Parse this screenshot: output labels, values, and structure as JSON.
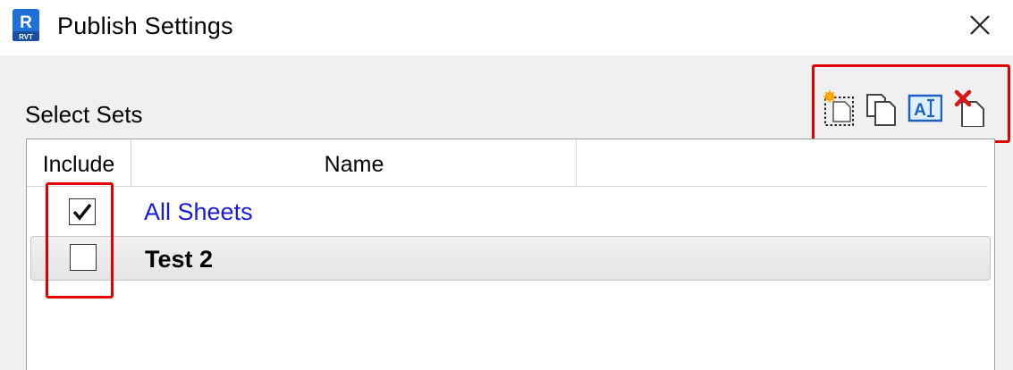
{
  "window": {
    "title": "Publish Settings",
    "app_icon_letter": "R",
    "app_icon_sub": "RVT"
  },
  "section": {
    "label": "Select Sets"
  },
  "toolbar": {
    "buttons": [
      {
        "icon": "new-set-icon"
      },
      {
        "icon": "duplicate-set-icon"
      },
      {
        "icon": "rename-set-icon"
      },
      {
        "icon": "delete-set-icon"
      }
    ]
  },
  "table": {
    "columns": [
      "Include",
      "Name"
    ],
    "rows": [
      {
        "name": "All Sheets",
        "include": true
      },
      {
        "name": "Test 2",
        "include": false
      }
    ]
  },
  "colors": {
    "highlight": "#e00000",
    "link": "#1a1ad6",
    "app_icon": "#1f6fd6"
  }
}
